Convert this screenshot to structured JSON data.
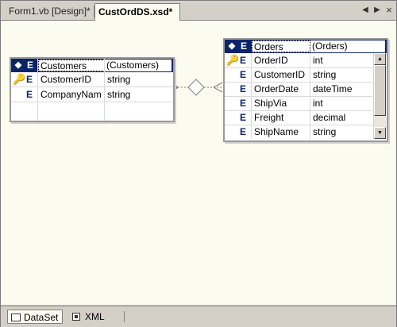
{
  "tabs": [
    {
      "label": "Form1.vb [Design]*",
      "active": false
    },
    {
      "label": "CustOrdDS.xsd*",
      "active": true
    }
  ],
  "nav": {
    "prev_icon": "triangle-left-icon",
    "next_icon": "triangle-right-icon",
    "close_icon": "close-icon"
  },
  "customers": {
    "header": {
      "icon": "E",
      "name": "Customers",
      "type": "(Customers)"
    },
    "rows": [
      {
        "key": true,
        "icon": "E",
        "name": "CustomerID",
        "type": "string"
      },
      {
        "key": false,
        "icon": "E",
        "name": "CompanyNam",
        "type": "string"
      }
    ]
  },
  "orders": {
    "header": {
      "icon": "E",
      "name": "Orders",
      "type": "(Orders)"
    },
    "rows": [
      {
        "key": true,
        "icon": "E",
        "name": "OrderID",
        "type": "int"
      },
      {
        "key": false,
        "icon": "E",
        "name": "CustomerID",
        "type": "string"
      },
      {
        "key": false,
        "icon": "E",
        "name": "OrderDate",
        "type": "dateTime"
      },
      {
        "key": false,
        "icon": "E",
        "name": "ShipVia",
        "type": "int"
      },
      {
        "key": false,
        "icon": "E",
        "name": "Freight",
        "type": "decimal"
      },
      {
        "key": false,
        "icon": "E",
        "name": "ShipName",
        "type": "string"
      }
    ]
  },
  "bottom_tabs": [
    {
      "label": "DataSet",
      "active": true
    },
    {
      "label": "XML",
      "active": false
    }
  ],
  "colors": {
    "selection": "#0a246a",
    "canvas": "#fbfbf0",
    "chrome": "#d4d0c8"
  }
}
